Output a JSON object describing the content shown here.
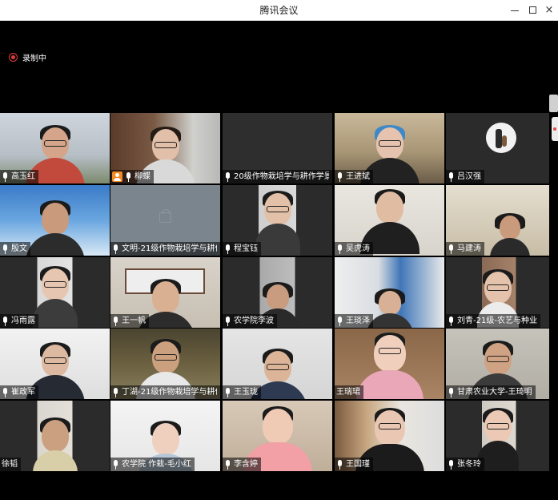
{
  "window": {
    "title": "腾讯会议",
    "minimize_label": "minimize",
    "maximize_label": "maximize",
    "close_label": "×"
  },
  "recording": {
    "label": "录制中",
    "color": "#e33b3b"
  },
  "participants": [
    {
      "name": "高玉红",
      "icon": "mic-icon"
    },
    {
      "name": "柳蝶",
      "icon": "host-icon"
    },
    {
      "name": "20级作物栽培学与耕作学景",
      "icon": "mic-icon"
    },
    {
      "name": "王进斌",
      "icon": "mic-icon"
    },
    {
      "name": "吕汉强",
      "icon": "mic-icon"
    },
    {
      "name": "殷文",
      "icon": "mic-icon"
    },
    {
      "name": "文明-21级作物栽培学与耕作",
      "icon": "mic-icon"
    },
    {
      "name": "程宝钰",
      "icon": "mic-icon"
    },
    {
      "name": "吴虎涛",
      "icon": "mic-icon"
    },
    {
      "name": "马建涛",
      "icon": "mic-icon"
    },
    {
      "name": "冯雨露",
      "icon": "mic-icon"
    },
    {
      "name": "王一帆",
      "icon": "mic-icon"
    },
    {
      "name": "农学院李波",
      "icon": "mic-icon"
    },
    {
      "name": "王琰泽",
      "icon": "mic-icon"
    },
    {
      "name": "刘青-21级-农艺与种业",
      "icon": "mic-icon"
    },
    {
      "name": "崔政军",
      "icon": "mic-icon"
    },
    {
      "name": "丁湖-21级作物栽培学与耕作",
      "icon": "mic-icon"
    },
    {
      "name": "王玉珑",
      "icon": "mic-icon"
    },
    {
      "name": "王瑞珺",
      "icon": "none"
    },
    {
      "name": "甘肃农业大学-王琦明",
      "icon": "mic-icon"
    },
    {
      "name": "徐韬",
      "icon": "none"
    },
    {
      "name": "农学院 作栽-毛小红",
      "icon": "mic-icon"
    },
    {
      "name": "李含婷",
      "icon": "mic-icon"
    },
    {
      "name": "王国瑾",
      "icon": "mic-icon"
    },
    {
      "name": "张冬玲",
      "icon": "mic-icon"
    }
  ]
}
